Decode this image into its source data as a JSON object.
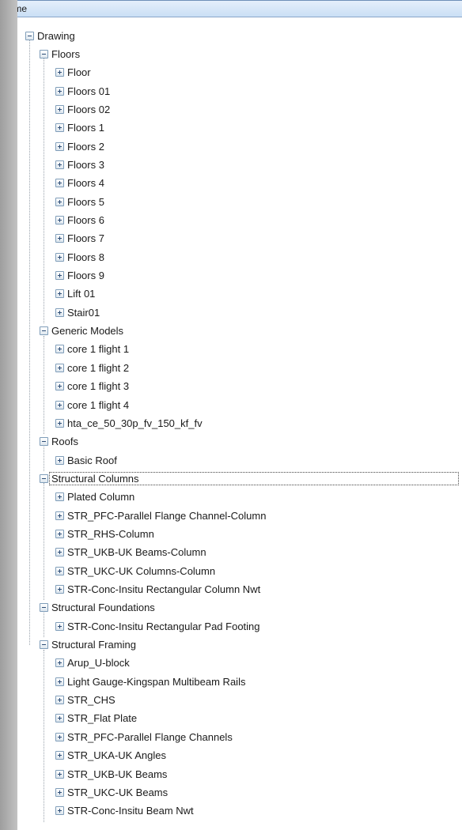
{
  "header": {
    "name_label": "Name"
  },
  "tree": {
    "label": "Drawing",
    "expanded": true,
    "groups": [
      {
        "label": "Floors",
        "expanded": true,
        "items": [
          "Floor",
          "Floors 01",
          "Floors 02",
          "Floors 1",
          "Floors 2",
          "Floors 3",
          "Floors 4",
          "Floors 5",
          "Floors 6",
          "Floors 7",
          "Floors 8",
          "Floors 9",
          "Lift 01",
          "Stair01"
        ]
      },
      {
        "label": "Generic Models",
        "expanded": true,
        "items": [
          "core 1 flight 1",
          "core 1 flight 2",
          "core 1 flight 3",
          "core 1 flight 4",
          "hta_ce_50_30p_fv_150_kf_fv"
        ]
      },
      {
        "label": "Roofs",
        "expanded": true,
        "items": [
          "Basic Roof"
        ]
      },
      {
        "label": "Structural Columns",
        "expanded": true,
        "selected": true,
        "items": [
          "Plated Column",
          "STR_PFC-Parallel Flange Channel-Column",
          "STR_RHS-Column",
          "STR_UKB-UK Beams-Column",
          "STR_UKC-UK Columns-Column",
          "STR-Conc-Insitu Rectangular Column Nwt"
        ]
      },
      {
        "label": "Structural Foundations",
        "expanded": true,
        "items": [
          "STR-Conc-Insitu Rectangular Pad Footing"
        ]
      },
      {
        "label": "Structural Framing",
        "expanded": true,
        "items": [
          "Arup_U-block",
          "Light Gauge-Kingspan Multibeam Rails",
          "STR_CHS",
          "STR_Flat Plate",
          "STR_PFC-Parallel Flange Channels",
          "STR_UKA-UK Angles",
          "STR_UKB-UK Beams",
          "STR_UKC-UK Beams",
          "STR-Conc-Insitu Beam Nwt"
        ]
      }
    ]
  }
}
